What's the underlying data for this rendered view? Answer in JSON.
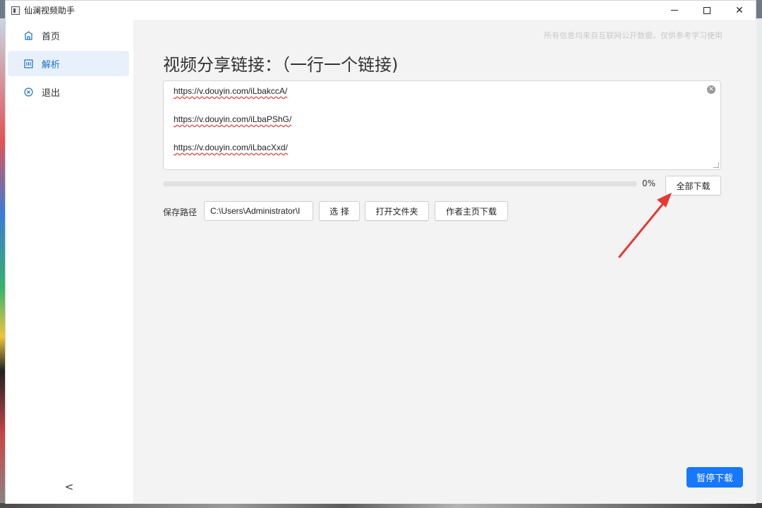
{
  "window": {
    "title": "仙澜视频助手"
  },
  "sidebar": {
    "items": [
      {
        "label": "首页",
        "icon": "home-icon"
      },
      {
        "label": "解析",
        "icon": "parse-icon",
        "active": true
      },
      {
        "label": "退出",
        "icon": "exit-icon"
      }
    ],
    "collapse_glyph": "<"
  },
  "main": {
    "disclaimer": "所有信息均来自互联网公开数据，仅供参考学习使用",
    "title": "视频分享链接：（一行一个链接)",
    "links": [
      "https://v.douyin.com/iLbakccA/",
      "https://v.douyin.com/iLbaPShG/",
      "https://v.douyin.com/iLbacXxd/"
    ],
    "progress": {
      "percent": 0,
      "label": "0%"
    },
    "download_all_label": "全部下载",
    "save_path_label": "保存路径",
    "save_path_value": "C:\\Users\\Administrator\\I",
    "choose_label": "选 择",
    "open_folder_label": "打开文件夹",
    "author_download_label": "作者主页下载",
    "pause_label": "暂停下载"
  },
  "colors": {
    "accent": "#1677ff",
    "active_nav_bg": "#e8f1fb",
    "annotation_arrow": "#e53935"
  }
}
